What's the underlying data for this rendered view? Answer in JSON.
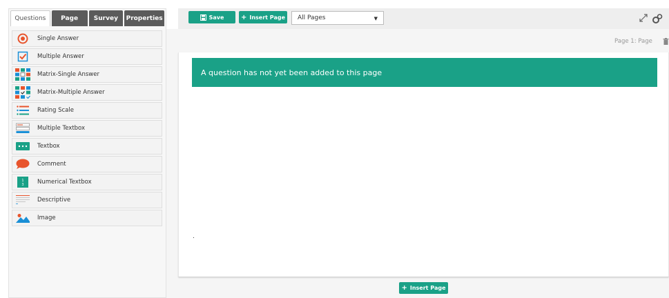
{
  "tabs": [
    {
      "label": "Questions"
    },
    {
      "label": "Page"
    },
    {
      "label": "Survey"
    },
    {
      "label": "Properties"
    }
  ],
  "questions": [
    {
      "label": "Single Answer",
      "icon": "single-answer-icon"
    },
    {
      "label": "Multiple Answer",
      "icon": "multiple-answer-icon"
    },
    {
      "label": "Matrix-Single Answer",
      "icon": "matrix-single-icon"
    },
    {
      "label": "Matrix-Multiple Answer",
      "icon": "matrix-multiple-icon"
    },
    {
      "label": "Rating Scale",
      "icon": "rating-scale-icon"
    },
    {
      "label": "Multiple Textbox",
      "icon": "multiple-textbox-icon"
    },
    {
      "label": "Textbox",
      "icon": "textbox-icon"
    },
    {
      "label": "Comment",
      "icon": "comment-icon"
    },
    {
      "label": "Numerical Textbox",
      "icon": "numerical-textbox-icon"
    },
    {
      "label": "Descriptive",
      "icon": "descriptive-icon"
    },
    {
      "label": "Image",
      "icon": "image-icon"
    }
  ],
  "toolbar": {
    "save_label": "Save",
    "insert_page_label": "Insert Page",
    "pages_select_value": "All Pages"
  },
  "page": {
    "page_label": "Page 1: Page",
    "empty_message": "A question has not yet been added to this page",
    "dot": ".",
    "insert_page_bottom_label": "Insert Page"
  },
  "colors": {
    "accent": "#1aa187",
    "tab_dark": "#5b5b5b"
  }
}
